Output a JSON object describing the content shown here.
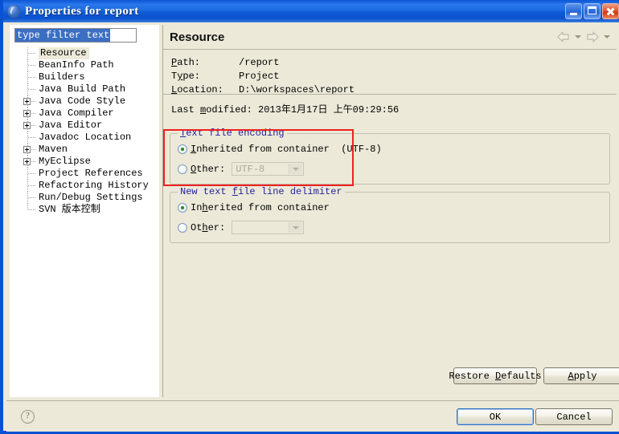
{
  "window": {
    "title": "Properties for report",
    "icon": "properties-icon",
    "buttons": {
      "minimize": "minimize-icon",
      "maximize": "maximize-icon",
      "close": "close-icon"
    }
  },
  "filter": {
    "value": "type filter text",
    "placeholder": "type filter text"
  },
  "tree": {
    "items": [
      {
        "label": "Resource",
        "expandable": false,
        "selected": true
      },
      {
        "label": "BeanInfo Path",
        "expandable": false,
        "selected": false
      },
      {
        "label": "Builders",
        "expandable": false,
        "selected": false
      },
      {
        "label": "Java Build Path",
        "expandable": false,
        "selected": false
      },
      {
        "label": "Java Code Style",
        "expandable": true,
        "selected": false
      },
      {
        "label": "Java Compiler",
        "expandable": true,
        "selected": false
      },
      {
        "label": "Java Editor",
        "expandable": true,
        "selected": false
      },
      {
        "label": "Javadoc Location",
        "expandable": false,
        "selected": false
      },
      {
        "label": "Maven",
        "expandable": true,
        "selected": false
      },
      {
        "label": "MyEclipse",
        "expandable": true,
        "selected": false
      },
      {
        "label": "Project References",
        "expandable": false,
        "selected": false
      },
      {
        "label": "Refactoring History",
        "expandable": false,
        "selected": false
      },
      {
        "label": "Run/Debug Settings",
        "expandable": false,
        "selected": false
      },
      {
        "label": "SVN 版本控制",
        "expandable": false,
        "selected": false
      }
    ]
  },
  "page": {
    "title": "Resource",
    "nav": {
      "back": "back-arrow-icon",
      "back_menu": "chevron-down-icon",
      "forward": "forward-arrow-icon",
      "forward_menu": "chevron-down-icon"
    },
    "info": {
      "path_label": "Path:",
      "path_value": "/report",
      "type_label": "Type:",
      "type_value": "Project",
      "location_label": "Location:",
      "location_value": "D:\\workspaces\\report",
      "last_modified_label": "Last modified:",
      "last_modified_value": "2013年1月17日 上午09:29:56"
    },
    "encoding_group": {
      "legend": "Text file encoding",
      "inherited_label": "Inherited from container  (UTF-8)",
      "inherited_selected": true,
      "other_label": "Other:",
      "other_selected": false,
      "other_value": "UTF-8"
    },
    "delimiter_group": {
      "legend": "New text file line delimiter",
      "inherited_label": "Inherited from container",
      "inherited_selected": true,
      "other_label": "Other:",
      "other_selected": false,
      "other_value": ""
    },
    "restore_defaults": "Restore Defaults",
    "apply": "Apply"
  },
  "footer": {
    "help": "help-icon",
    "ok": "OK",
    "cancel": "Cancel"
  },
  "colors": {
    "titlebar_blue": "#1c6bdf",
    "window_border": "#0a50d2",
    "dialog_bg": "#ece9d8",
    "group_legend": "#23239e",
    "annotation_red": "#ef2020",
    "selection_blue": "#3c6fc4",
    "radio_dot_green": "#1e8a1e"
  }
}
